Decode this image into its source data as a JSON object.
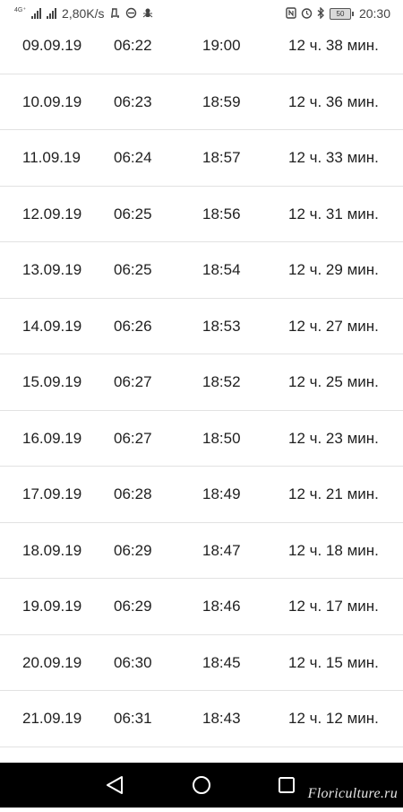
{
  "status_bar": {
    "network_type": "4G⁺",
    "speed": "2,80K/s",
    "notification_icons": [
      "d-icon",
      "sync-icon",
      "bug-icon"
    ],
    "right_icons": [
      "nfc-icon",
      "alarm-icon",
      "bluetooth-icon"
    ],
    "battery_level": "50",
    "time": "20:30"
  },
  "table": {
    "rows": [
      {
        "date": "09.09.19",
        "sunrise": "06:22",
        "sunset": "19:00",
        "day_length": "12 ч. 38 мин."
      },
      {
        "date": "10.09.19",
        "sunrise": "06:23",
        "sunset": "18:59",
        "day_length": "12 ч. 36 мин."
      },
      {
        "date": "11.09.19",
        "sunrise": "06:24",
        "sunset": "18:57",
        "day_length": "12 ч. 33 мин."
      },
      {
        "date": "12.09.19",
        "sunrise": "06:25",
        "sunset": "18:56",
        "day_length": "12 ч. 31 мин."
      },
      {
        "date": "13.09.19",
        "sunrise": "06:25",
        "sunset": "18:54",
        "day_length": "12 ч. 29 мин."
      },
      {
        "date": "14.09.19",
        "sunrise": "06:26",
        "sunset": "18:53",
        "day_length": "12 ч. 27 мин."
      },
      {
        "date": "15.09.19",
        "sunrise": "06:27",
        "sunset": "18:52",
        "day_length": "12 ч. 25 мин."
      },
      {
        "date": "16.09.19",
        "sunrise": "06:27",
        "sunset": "18:50",
        "day_length": "12 ч. 23 мин."
      },
      {
        "date": "17.09.19",
        "sunrise": "06:28",
        "sunset": "18:49",
        "day_length": "12 ч. 21 мин."
      },
      {
        "date": "18.09.19",
        "sunrise": "06:29",
        "sunset": "18:47",
        "day_length": "12 ч. 18 мин."
      },
      {
        "date": "19.09.19",
        "sunrise": "06:29",
        "sunset": "18:46",
        "day_length": "12 ч. 17 мин."
      },
      {
        "date": "20.09.19",
        "sunrise": "06:30",
        "sunset": "18:45",
        "day_length": "12 ч. 15 мин."
      },
      {
        "date": "21.09.19",
        "sunrise": "06:31",
        "sunset": "18:43",
        "day_length": "12 ч. 12 мин."
      }
    ]
  },
  "nav_bar": {
    "buttons": [
      "back-icon",
      "home-icon",
      "recent-apps-icon"
    ],
    "watermark": "Floriculture.ru"
  }
}
